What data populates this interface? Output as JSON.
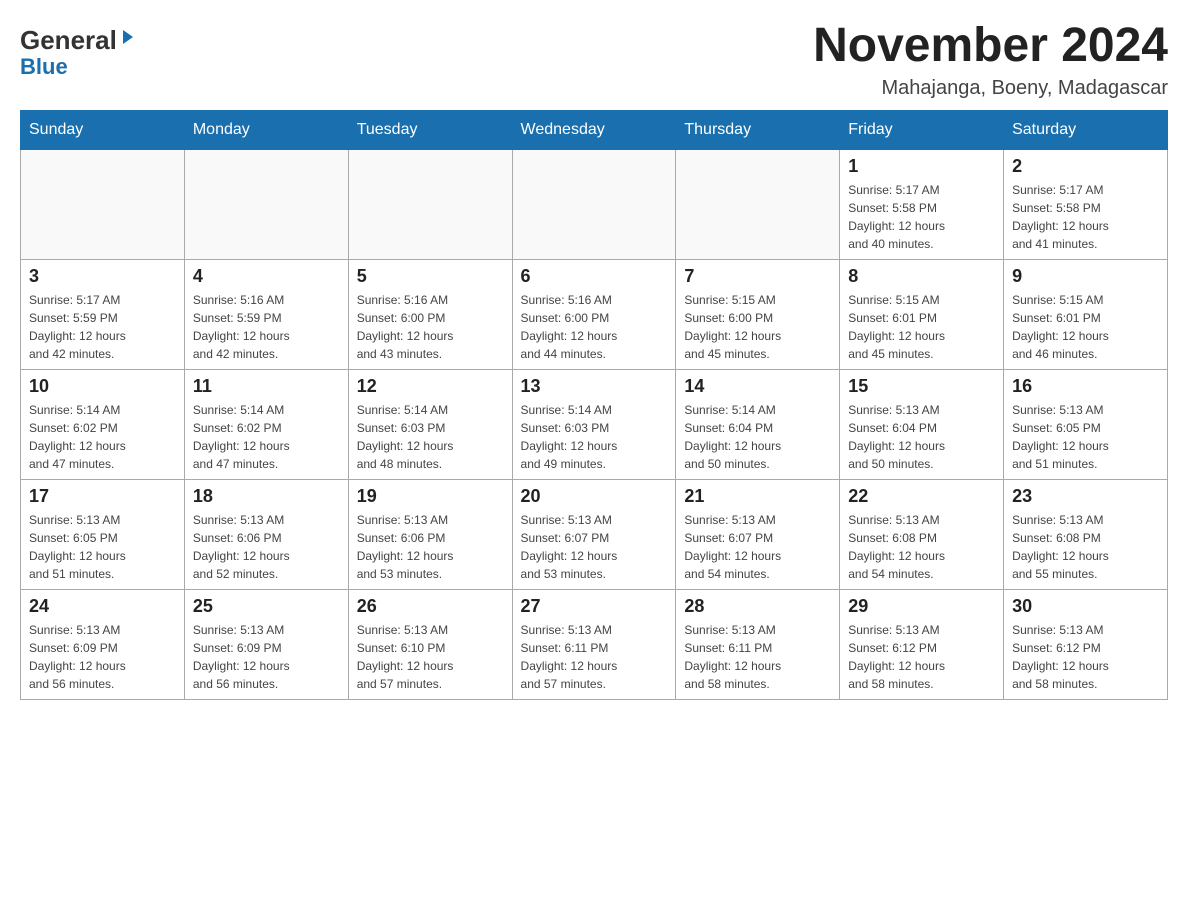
{
  "header": {
    "logo_general": "General",
    "logo_blue": "Blue",
    "title": "November 2024",
    "subtitle": "Mahajanga, Boeny, Madagascar"
  },
  "days_of_week": [
    "Sunday",
    "Monday",
    "Tuesday",
    "Wednesday",
    "Thursday",
    "Friday",
    "Saturday"
  ],
  "weeks": [
    [
      {
        "day": "",
        "info": ""
      },
      {
        "day": "",
        "info": ""
      },
      {
        "day": "",
        "info": ""
      },
      {
        "day": "",
        "info": ""
      },
      {
        "day": "",
        "info": ""
      },
      {
        "day": "1",
        "info": "Sunrise: 5:17 AM\nSunset: 5:58 PM\nDaylight: 12 hours\nand 40 minutes."
      },
      {
        "day": "2",
        "info": "Sunrise: 5:17 AM\nSunset: 5:58 PM\nDaylight: 12 hours\nand 41 minutes."
      }
    ],
    [
      {
        "day": "3",
        "info": "Sunrise: 5:17 AM\nSunset: 5:59 PM\nDaylight: 12 hours\nand 42 minutes."
      },
      {
        "day": "4",
        "info": "Sunrise: 5:16 AM\nSunset: 5:59 PM\nDaylight: 12 hours\nand 42 minutes."
      },
      {
        "day": "5",
        "info": "Sunrise: 5:16 AM\nSunset: 6:00 PM\nDaylight: 12 hours\nand 43 minutes."
      },
      {
        "day": "6",
        "info": "Sunrise: 5:16 AM\nSunset: 6:00 PM\nDaylight: 12 hours\nand 44 minutes."
      },
      {
        "day": "7",
        "info": "Sunrise: 5:15 AM\nSunset: 6:00 PM\nDaylight: 12 hours\nand 45 minutes."
      },
      {
        "day": "8",
        "info": "Sunrise: 5:15 AM\nSunset: 6:01 PM\nDaylight: 12 hours\nand 45 minutes."
      },
      {
        "day": "9",
        "info": "Sunrise: 5:15 AM\nSunset: 6:01 PM\nDaylight: 12 hours\nand 46 minutes."
      }
    ],
    [
      {
        "day": "10",
        "info": "Sunrise: 5:14 AM\nSunset: 6:02 PM\nDaylight: 12 hours\nand 47 minutes."
      },
      {
        "day": "11",
        "info": "Sunrise: 5:14 AM\nSunset: 6:02 PM\nDaylight: 12 hours\nand 47 minutes."
      },
      {
        "day": "12",
        "info": "Sunrise: 5:14 AM\nSunset: 6:03 PM\nDaylight: 12 hours\nand 48 minutes."
      },
      {
        "day": "13",
        "info": "Sunrise: 5:14 AM\nSunset: 6:03 PM\nDaylight: 12 hours\nand 49 minutes."
      },
      {
        "day": "14",
        "info": "Sunrise: 5:14 AM\nSunset: 6:04 PM\nDaylight: 12 hours\nand 50 minutes."
      },
      {
        "day": "15",
        "info": "Sunrise: 5:13 AM\nSunset: 6:04 PM\nDaylight: 12 hours\nand 50 minutes."
      },
      {
        "day": "16",
        "info": "Sunrise: 5:13 AM\nSunset: 6:05 PM\nDaylight: 12 hours\nand 51 minutes."
      }
    ],
    [
      {
        "day": "17",
        "info": "Sunrise: 5:13 AM\nSunset: 6:05 PM\nDaylight: 12 hours\nand 51 minutes."
      },
      {
        "day": "18",
        "info": "Sunrise: 5:13 AM\nSunset: 6:06 PM\nDaylight: 12 hours\nand 52 minutes."
      },
      {
        "day": "19",
        "info": "Sunrise: 5:13 AM\nSunset: 6:06 PM\nDaylight: 12 hours\nand 53 minutes."
      },
      {
        "day": "20",
        "info": "Sunrise: 5:13 AM\nSunset: 6:07 PM\nDaylight: 12 hours\nand 53 minutes."
      },
      {
        "day": "21",
        "info": "Sunrise: 5:13 AM\nSunset: 6:07 PM\nDaylight: 12 hours\nand 54 minutes."
      },
      {
        "day": "22",
        "info": "Sunrise: 5:13 AM\nSunset: 6:08 PM\nDaylight: 12 hours\nand 54 minutes."
      },
      {
        "day": "23",
        "info": "Sunrise: 5:13 AM\nSunset: 6:08 PM\nDaylight: 12 hours\nand 55 minutes."
      }
    ],
    [
      {
        "day": "24",
        "info": "Sunrise: 5:13 AM\nSunset: 6:09 PM\nDaylight: 12 hours\nand 56 minutes."
      },
      {
        "day": "25",
        "info": "Sunrise: 5:13 AM\nSunset: 6:09 PM\nDaylight: 12 hours\nand 56 minutes."
      },
      {
        "day": "26",
        "info": "Sunrise: 5:13 AM\nSunset: 6:10 PM\nDaylight: 12 hours\nand 57 minutes."
      },
      {
        "day": "27",
        "info": "Sunrise: 5:13 AM\nSunset: 6:11 PM\nDaylight: 12 hours\nand 57 minutes."
      },
      {
        "day": "28",
        "info": "Sunrise: 5:13 AM\nSunset: 6:11 PM\nDaylight: 12 hours\nand 58 minutes."
      },
      {
        "day": "29",
        "info": "Sunrise: 5:13 AM\nSunset: 6:12 PM\nDaylight: 12 hours\nand 58 minutes."
      },
      {
        "day": "30",
        "info": "Sunrise: 5:13 AM\nSunset: 6:12 PM\nDaylight: 12 hours\nand 58 minutes."
      }
    ]
  ]
}
